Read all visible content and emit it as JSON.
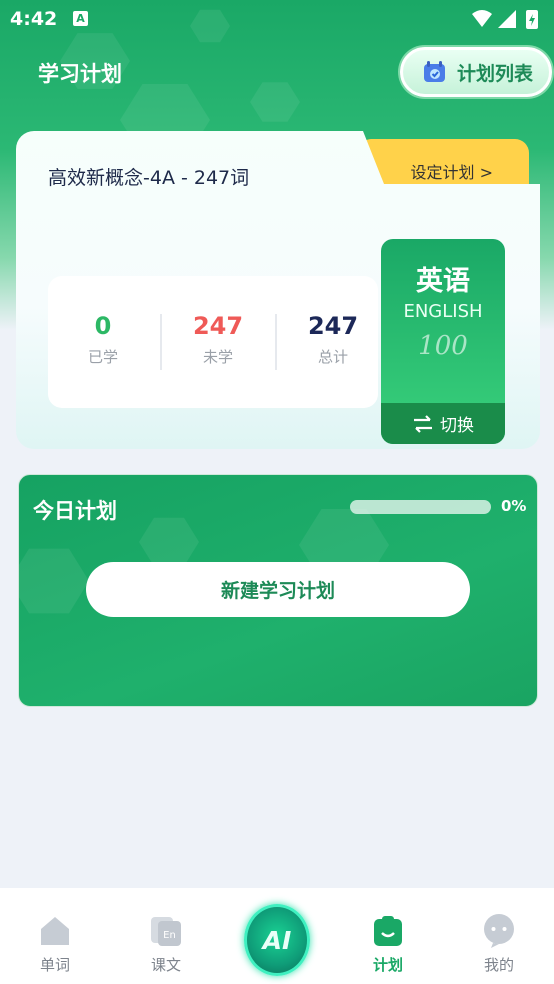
{
  "status_bar": {
    "time": "4:42",
    "notification_badge": "A",
    "icons": [
      "wifi-icon",
      "signal-icon",
      "battery-icon"
    ]
  },
  "header": {
    "title": "学习计划",
    "plan_list_label": "计划列表"
  },
  "book_card": {
    "title": "高效新概念-4A - 247词",
    "set_plan_label": "设定计划 >",
    "stats": [
      {
        "value": "0",
        "caption": "已学",
        "color": "#2cb865"
      },
      {
        "value": "247",
        "caption": "未学",
        "color": "#ef5a57"
      },
      {
        "value": "247",
        "caption": "总计",
        "color": "#1c2858"
      }
    ],
    "english_card": {
      "title": "英语",
      "subtitle": "ENGLISH",
      "mark": "100",
      "switch_label": "切换"
    }
  },
  "today_plan": {
    "title": "今日计划",
    "progress_fraction": 0,
    "progress_text": "0%",
    "new_plan_label": "新建学习计划"
  },
  "bottom_nav": {
    "items": [
      {
        "label": "单词",
        "icon": "house-icon",
        "active": false
      },
      {
        "label": "课文",
        "icon": "text-icon",
        "active": false
      },
      {
        "label": "计划",
        "icon": "clipboard-icon",
        "active": true
      },
      {
        "label": "我的",
        "icon": "profile-icon",
        "active": false
      }
    ],
    "ai_label": "AI"
  },
  "colors": {
    "brand_green": "#1aa866",
    "accent_yellow": "#ffd24a",
    "unlearned_red": "#ef5a57",
    "total_navy": "#1c2858"
  }
}
